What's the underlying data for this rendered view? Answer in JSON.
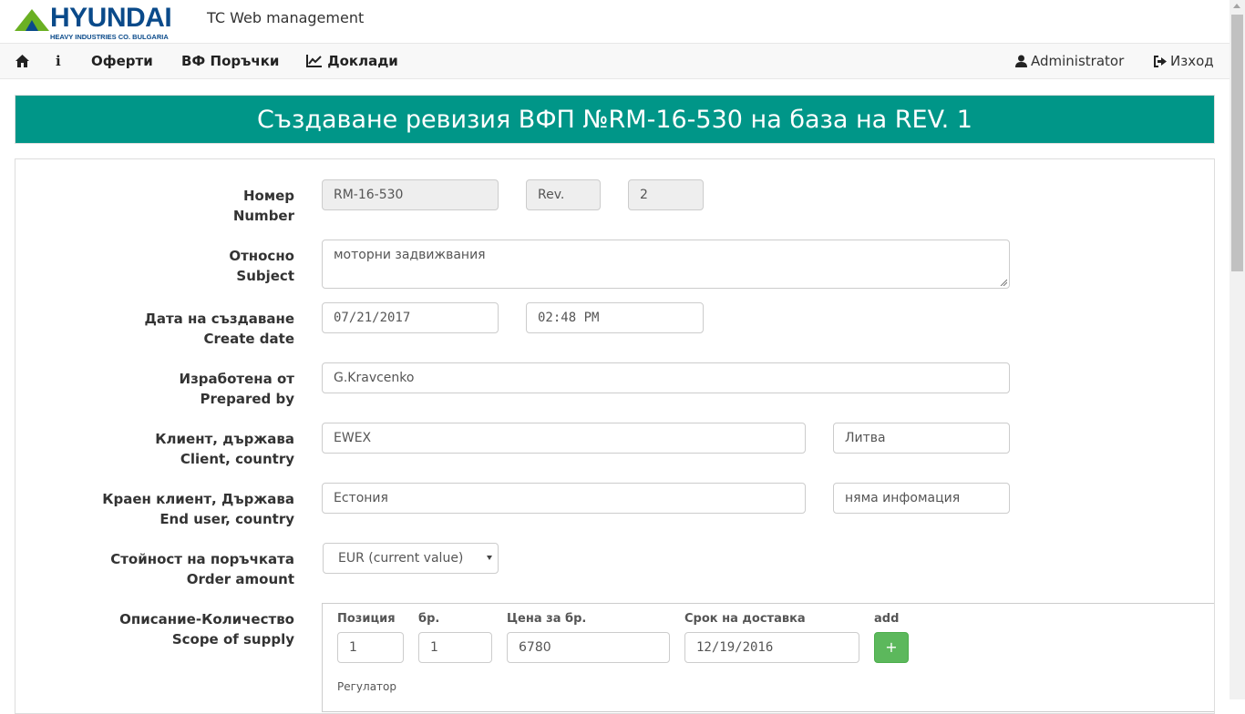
{
  "brand": {
    "logo_word": "HYUNDAI",
    "logo_sub": "HEAVY INDUSTRIES CO. BULGARIA",
    "app_title": "TC Web management"
  },
  "nav": {
    "home_icon": "home-icon",
    "info_icon": "info-icon",
    "offers": "Оферти",
    "orders": "ВФ Поръчки",
    "reports": "Доклади",
    "reports_icon": "line-chart-icon",
    "user": "Administrator",
    "user_icon": "user-icon",
    "logout": "Изход",
    "logout_icon": "sign-out-icon"
  },
  "banner": {
    "title": "Създаване ревизия ВФП №RM-16-530 на база на REV. 1"
  },
  "form": {
    "number": {
      "label_bg": "Номер",
      "label_en": "Number",
      "value": "RM-16-530",
      "rev_label": "Rev.",
      "rev_value": "2"
    },
    "subject": {
      "label_bg": "Относно",
      "label_en": "Subject",
      "value": "моторни задвижвания"
    },
    "create_date": {
      "label_bg": "Дата на създаване",
      "label_en": "Create date",
      "date": "07/21/2017",
      "time": "02:48 PM"
    },
    "prepared_by": {
      "label_bg": "Изработена от",
      "label_en": "Prepared by",
      "value": "G.Kravcenko"
    },
    "client": {
      "label_bg": "Клиент, държава",
      "label_en": "Client, country",
      "name": "EWEX",
      "country": "Литва"
    },
    "end_user": {
      "label_bg": "Краен клиент, Държава",
      "label_en": "End user, country",
      "name": "Естония",
      "country": "няма инфомация"
    },
    "order_amount": {
      "label_bg": "Стойност на поръчката",
      "label_en": "Order amount",
      "selected": "EUR (current value)"
    },
    "scope": {
      "label_bg": "Описание-Количество",
      "label_en": "Scope of supply",
      "headers": {
        "position": "Позиция",
        "qty": "бр.",
        "unit_price": "Цена за бр.",
        "delivery": "Срок на доставка",
        "add": "add"
      },
      "row": {
        "position": "1",
        "qty": "1",
        "unit_price": "6780",
        "delivery": "12/19/2016"
      },
      "add_button": "+",
      "description_label": "Регулатор"
    }
  },
  "colors": {
    "banner": "#009688",
    "logo_blue": "#0a4a8a",
    "logo_green": "#6ab023",
    "add_button": "#5cb85c"
  }
}
